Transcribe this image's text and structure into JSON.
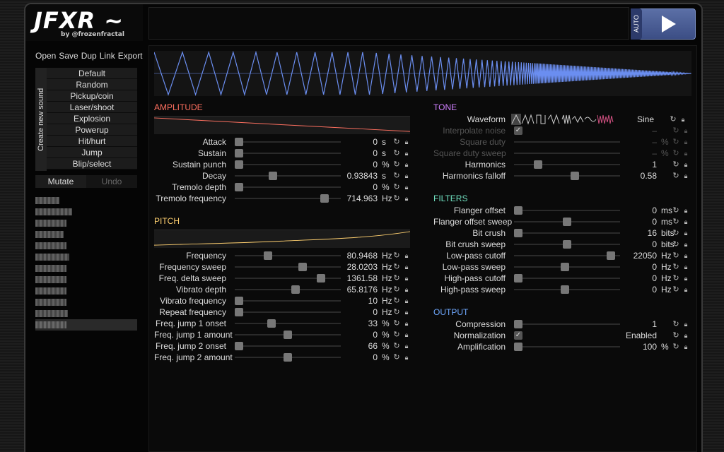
{
  "header": {
    "logo": "JFXR ~",
    "byline": "by @frozenfractal",
    "auto_label": "AUTO"
  },
  "file_menu": [
    "Open",
    "Save",
    "Dup",
    "Link",
    "Export"
  ],
  "create_label": "Create new sound",
  "presets": [
    "Default",
    "Random",
    "Pickup/coin",
    "Laser/shoot",
    "Explosion",
    "Powerup",
    "Hit/hurt",
    "Jump",
    "Blip/select"
  ],
  "mutate_label": "Mutate",
  "undo_label": "Undo",
  "history_count": 12,
  "sections": {
    "amplitude": "AMPLITUDE",
    "pitch": "PITCH",
    "tone": "TONE",
    "filters": "FILTERS",
    "output": "OUTPUT"
  },
  "amplitude": [
    {
      "label": "Attack",
      "value": "0",
      "unit": "s",
      "pos": 0.0
    },
    {
      "label": "Sustain",
      "value": "0",
      "unit": "s",
      "pos": 0.0
    },
    {
      "label": "Sustain punch",
      "value": "0",
      "unit": "%",
      "pos": 0.0
    },
    {
      "label": "Decay",
      "value": "0.93843",
      "unit": "s",
      "pos": 0.35
    },
    {
      "label": "Tremolo depth",
      "value": "0",
      "unit": "%",
      "pos": 0.0
    },
    {
      "label": "Tremolo frequency",
      "value": "714.963",
      "unit": "Hz",
      "pos": 0.88
    }
  ],
  "pitch": [
    {
      "label": "Frequency",
      "value": "80.9468",
      "unit": "Hz",
      "pos": 0.3
    },
    {
      "label": "Frequency sweep",
      "value": "28.0203",
      "unit": "Hz",
      "pos": 0.65
    },
    {
      "label": "Freq. delta sweep",
      "value": "1361.58",
      "unit": "Hz",
      "pos": 0.84
    },
    {
      "label": "Vibrato depth",
      "value": "65.8176",
      "unit": "Hz",
      "pos": 0.58
    },
    {
      "label": "Vibrato frequency",
      "value": "10",
      "unit": "Hz",
      "pos": 0.0
    },
    {
      "label": "Repeat frequency",
      "value": "0",
      "unit": "Hz",
      "pos": 0.0
    },
    {
      "label": "Freq. jump 1 onset",
      "value": "33",
      "unit": "%",
      "pos": 0.33
    },
    {
      "label": "Freq. jump 1 amount",
      "value": "0",
      "unit": "%",
      "pos": 0.5
    },
    {
      "label": "Freq. jump 2 onset",
      "value": "66",
      "unit": "%",
      "pos": 0.0
    },
    {
      "label": "Freq. jump 2 amount",
      "value": "0",
      "unit": "%",
      "pos": 0.5
    }
  ],
  "tone": {
    "waveform_label": "Waveform",
    "waveform_value": "Sine",
    "rows": [
      {
        "label": "Interpolate noise",
        "value": "–",
        "unit": "",
        "disabled": true,
        "check": true
      },
      {
        "label": "Square duty",
        "value": "–",
        "unit": "%",
        "disabled": true
      },
      {
        "label": "Square duty sweep",
        "value": "–",
        "unit": "%",
        "disabled": true
      },
      {
        "label": "Harmonics",
        "value": "1",
        "unit": "",
        "pos": 0.2
      },
      {
        "label": "Harmonics falloff",
        "value": "0.58",
        "unit": "",
        "pos": 0.58
      }
    ]
  },
  "filters": [
    {
      "label": "Flanger offset",
      "value": "0",
      "unit": "ms",
      "pos": 0.0
    },
    {
      "label": "Flanger offset sweep",
      "value": "0",
      "unit": "ms",
      "pos": 0.5
    },
    {
      "label": "Bit crush",
      "value": "16",
      "unit": "bits",
      "pos": 0.0
    },
    {
      "label": "Bit crush sweep",
      "value": "0",
      "unit": "bits",
      "pos": 0.5
    },
    {
      "label": "Low-pass cutoff",
      "value": "22050",
      "unit": "Hz",
      "pos": 0.95
    },
    {
      "label": "Low-pass sweep",
      "value": "0",
      "unit": "Hz",
      "pos": 0.48
    },
    {
      "label": "High-pass cutoff",
      "value": "0",
      "unit": "Hz",
      "pos": 0.0
    },
    {
      "label": "High-pass sweep",
      "value": "0",
      "unit": "Hz",
      "pos": 0.48
    }
  ],
  "output": [
    {
      "label": "Compression",
      "value": "1",
      "unit": "",
      "pos": 0.0
    },
    {
      "label": "Normalization",
      "value": "Enabled",
      "unit": "",
      "check": true
    },
    {
      "label": "Amplification",
      "value": "100",
      "unit": "%",
      "pos": 0.0
    }
  ]
}
